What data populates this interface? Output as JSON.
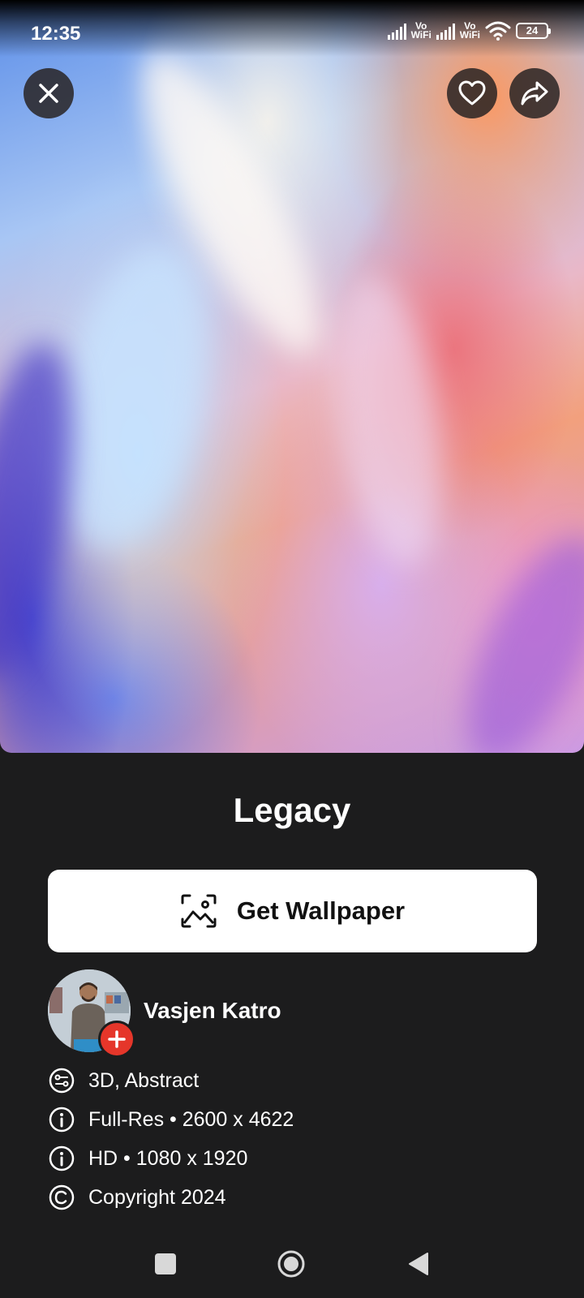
{
  "status_bar": {
    "time": "12:35",
    "network_label": "Vo WiFi",
    "battery": "24"
  },
  "wallpaper": {
    "title": "Legacy",
    "tags": "3D, Abstract",
    "full_res": "Full-Res • 2600 x 4622",
    "hd": "HD • 1080 x 1920",
    "copyright": "Copyright 2024"
  },
  "actions": {
    "get_wallpaper_label": "Get Wallpaper"
  },
  "author": {
    "name": "Vasjen Katro"
  },
  "icons": {
    "close": "close-icon",
    "favorite": "heart-icon",
    "share": "share-icon",
    "get_wallpaper": "image-frame-icon",
    "follow": "plus-icon",
    "tags": "tags-icon",
    "info": "info-icon",
    "copyright": "copyright-icon"
  },
  "colors": {
    "background": "#1c1c1d",
    "button": "#ffffff",
    "follow_badge": "#e5362a"
  }
}
